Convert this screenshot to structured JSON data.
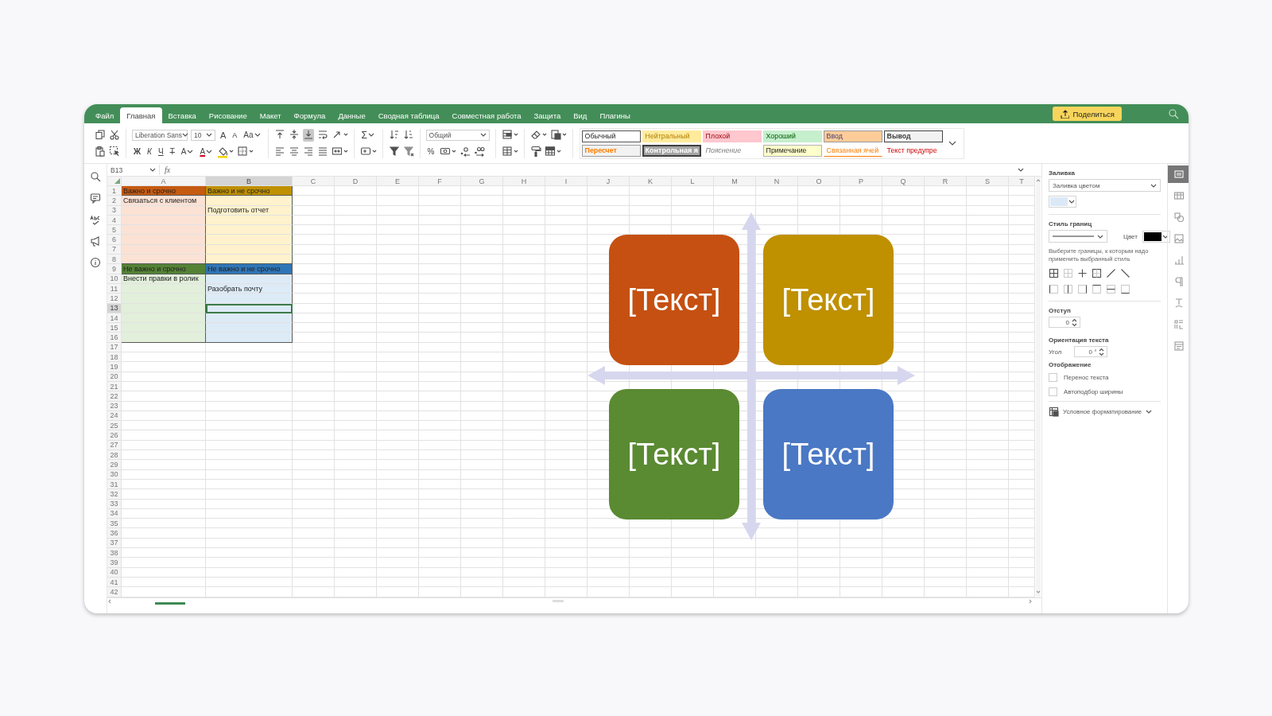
{
  "menu_tabs": [
    {
      "label": "Файл",
      "selected": false
    },
    {
      "label": "Главная",
      "selected": true
    },
    {
      "label": "Вставка",
      "selected": false
    },
    {
      "label": "Рисование",
      "selected": false
    },
    {
      "label": "Макет",
      "selected": false
    },
    {
      "label": "Формула",
      "selected": false
    },
    {
      "label": "Данные",
      "selected": false
    },
    {
      "label": "Сводная таблица",
      "selected": false
    },
    {
      "label": "Совместная работа",
      "selected": false
    },
    {
      "label": "Защита",
      "selected": false
    },
    {
      "label": "Вид",
      "selected": false
    },
    {
      "label": "Плагины",
      "selected": false
    }
  ],
  "share_button": "Поделиться",
  "toolbar": {
    "font_name": "Liberation Sans",
    "font_size": "10",
    "grow_font": "A",
    "shrink_font": "A",
    "change_case": "Aa",
    "bold": "Ж",
    "italic": "К",
    "underline": "Ч",
    "strikethrough": "Т",
    "subscript": "A",
    "font_color": "A",
    "sum": "Σ",
    "number_format": "Общий",
    "percent": "%"
  },
  "cell_styles": [
    {
      "label": "Обычный",
      "kind": "normal"
    },
    {
      "label": "Нейтральный",
      "kind": "neutral"
    },
    {
      "label": "Плохой",
      "kind": "bad"
    },
    {
      "label": "Хороший",
      "kind": "good"
    },
    {
      "label": "Ввод",
      "kind": "input"
    },
    {
      "label": "Вывод",
      "kind": "output"
    },
    {
      "label": "Пересчет",
      "kind": "calculation"
    },
    {
      "label": "Контрольная я",
      "kind": "check"
    },
    {
      "label": "Пояснение",
      "kind": "explanatory"
    },
    {
      "label": "Примечание",
      "kind": "note"
    },
    {
      "label": "Связанная ячей",
      "kind": "linked"
    },
    {
      "label": "Текст предупре",
      "kind": "warning"
    }
  ],
  "name_box": "B13",
  "formula_label": "fx",
  "columns": [
    {
      "label": "A",
      "selected": false
    },
    {
      "label": "B",
      "selected": true
    },
    {
      "label": "C",
      "selected": false
    },
    {
      "label": "D",
      "selected": false
    },
    {
      "label": "E",
      "selected": false
    },
    {
      "label": "F",
      "selected": false
    },
    {
      "label": "G",
      "selected": false
    },
    {
      "label": "H",
      "selected": false
    },
    {
      "label": "I",
      "selected": false
    },
    {
      "label": "J",
      "selected": false
    },
    {
      "label": "K",
      "selected": false
    },
    {
      "label": "L",
      "selected": false
    },
    {
      "label": "M",
      "selected": false
    },
    {
      "label": "N",
      "selected": false
    },
    {
      "label": "O",
      "selected": false
    },
    {
      "label": "P",
      "selected": false
    },
    {
      "label": "Q",
      "selected": false
    },
    {
      "label": "R",
      "selected": false
    },
    {
      "label": "S",
      "selected": false
    },
    {
      "label": "T",
      "selected": false
    }
  ],
  "rows": [
    {
      "label": "1",
      "selected": false,
      "cells": [
        {
          "text": "Важно и срочно",
          "color": "#c55a11",
          "selected": false
        },
        {
          "text": "Важно и не срочно",
          "color": "#bf9000",
          "selected": false
        }
      ]
    },
    {
      "label": "2",
      "selected": false,
      "cells": [
        {
          "text": "Связаться с клиентом",
          "color": "#fbe2d5",
          "selected": false
        },
        {
          "color": "#fff2cc",
          "selected": false
        }
      ]
    },
    {
      "label": "3",
      "selected": false,
      "cells": [
        {
          "color": "#fbe2d5",
          "selected": false
        },
        {
          "text": "Подготовить отчет",
          "color": "#fff2cc",
          "selected": false
        }
      ]
    },
    {
      "label": "4",
      "selected": false,
      "cells": [
        {
          "color": "#fbe2d5",
          "selected": false
        },
        {
          "color": "#fff2cc",
          "selected": false
        }
      ]
    },
    {
      "label": "5",
      "selected": false,
      "cells": [
        {
          "color": "#fbe2d5",
          "selected": false
        },
        {
          "color": "#fff2cc",
          "selected": false
        }
      ]
    },
    {
      "label": "6",
      "selected": false,
      "cells": [
        {
          "color": "#fbe2d5",
          "selected": false
        },
        {
          "color": "#fff2cc",
          "selected": false
        }
      ]
    },
    {
      "label": "7",
      "selected": false,
      "cells": [
        {
          "color": "#fbe2d5",
          "selected": false
        },
        {
          "color": "#fff2cc",
          "selected": false
        }
      ]
    },
    {
      "label": "8",
      "selected": false,
      "cells": [
        {
          "color": "#fbe2d5",
          "selected": false
        },
        {
          "color": "#fff2cc",
          "selected": false
        }
      ]
    },
    {
      "label": "9",
      "selected": false,
      "cells": [
        {
          "text": "Не важно и срочно",
          "color": "#548235",
          "selected": false
        },
        {
          "text": "Не важно и не срочно",
          "color": "#2e75b6",
          "selected": false
        }
      ]
    },
    {
      "label": "10",
      "selected": false,
      "cells": [
        {
          "text": "Внести правки в ролик",
          "color": "#e2efda",
          "selected": false
        },
        {
          "color": "#ddebf7",
          "selected": false
        }
      ]
    },
    {
      "label": "11",
      "selected": false,
      "cells": [
        {
          "color": "#e2efda",
          "selected": false
        },
        {
          "text": "Разобрать почту",
          "color": "#ddebf7",
          "selected": false
        }
      ]
    },
    {
      "label": "12",
      "selected": false,
      "cells": [
        {
          "color": "#e2efda",
          "selected": false
        },
        {
          "color": "#ddebf7",
          "selected": false
        }
      ]
    },
    {
      "label": "13",
      "selected": true,
      "cells": [
        {
          "color": "#e2efda",
          "selected": false
        },
        {
          "color": "#ddebf7",
          "selected": true
        }
      ]
    },
    {
      "label": "14",
      "selected": false,
      "cells": [
        {
          "color": "#e2efda",
          "selected": false
        },
        {
          "color": "#ddebf7",
          "selected": false
        }
      ]
    },
    {
      "label": "15",
      "selected": false,
      "cells": [
        {
          "color": "#e2efda",
          "selected": false
        },
        {
          "color": "#ddebf7",
          "selected": false
        }
      ]
    },
    {
      "label": "16",
      "selected": false,
      "cells": [
        {
          "color": "#e2efda",
          "selected": false
        },
        {
          "color": "#ddebf7",
          "selected": false
        }
      ]
    },
    {
      "label": "17",
      "selected": false
    },
    {
      "label": "18",
      "selected": false
    },
    {
      "label": "19",
      "selected": false
    },
    {
      "label": "20",
      "selected": false
    },
    {
      "label": "21",
      "selected": false
    },
    {
      "label": "22",
      "selected": false
    },
    {
      "label": "23",
      "selected": false
    },
    {
      "label": "24",
      "selected": false
    },
    {
      "label": "25",
      "selected": false
    },
    {
      "label": "26",
      "selected": false
    },
    {
      "label": "27",
      "selected": false
    },
    {
      "label": "28",
      "selected": false
    },
    {
      "label": "29",
      "selected": false
    },
    {
      "label": "30",
      "selected": false
    },
    {
      "label": "31",
      "selected": false
    },
    {
      "label": "32",
      "selected": false
    },
    {
      "label": "33",
      "selected": false
    },
    {
      "label": "34",
      "selected": false
    },
    {
      "label": "35",
      "selected": false
    },
    {
      "label": "36",
      "selected": false
    },
    {
      "label": "37",
      "selected": false
    },
    {
      "label": "38",
      "selected": false
    },
    {
      "label": "39",
      "selected": false
    },
    {
      "label": "40",
      "selected": false
    },
    {
      "label": "41",
      "selected": false
    },
    {
      "label": "42",
      "selected": false
    }
  ],
  "diagram": {
    "boxes": [
      {
        "text": "[Текст]",
        "color": "#c55012"
      },
      {
        "text": "[Текст]",
        "color": "#bf9000"
      },
      {
        "text": "[Текст]",
        "color": "#5a8a32"
      },
      {
        "text": "[Текст]",
        "color": "#4a78c4"
      }
    ]
  },
  "format_panel": {
    "fill_title": "Заливка",
    "fill_type": "Заливка цветом",
    "fill_swatch": {
      "color": "#dbe9f7"
    },
    "border_title": "Стиль границ",
    "border_color_label": "Цвет",
    "border_swatch": {
      "color": "#000000"
    },
    "border_hint": "Выберите границы, к которым надо применить выбранный стиль",
    "indent_title": "Отступ",
    "indent_value": "0",
    "orientation_title": "Ориентация текста",
    "angle_label": "Угол",
    "angle_value": "0 °",
    "display_title": "Отображение",
    "checkboxes": [
      {
        "label": "Перенос текста",
        "checked": false
      },
      {
        "label": "Автоподбор ширины",
        "checked": false
      }
    ],
    "conditional_button": "Условное форматирование"
  },
  "side_tabs": [
    {
      "selected": true
    },
    {
      "selected": false
    },
    {
      "selected": false
    },
    {
      "selected": false
    },
    {
      "selected": false
    },
    {
      "selected": false
    },
    {
      "selected": false
    },
    {
      "selected": false
    },
    {
      "selected": false
    }
  ]
}
